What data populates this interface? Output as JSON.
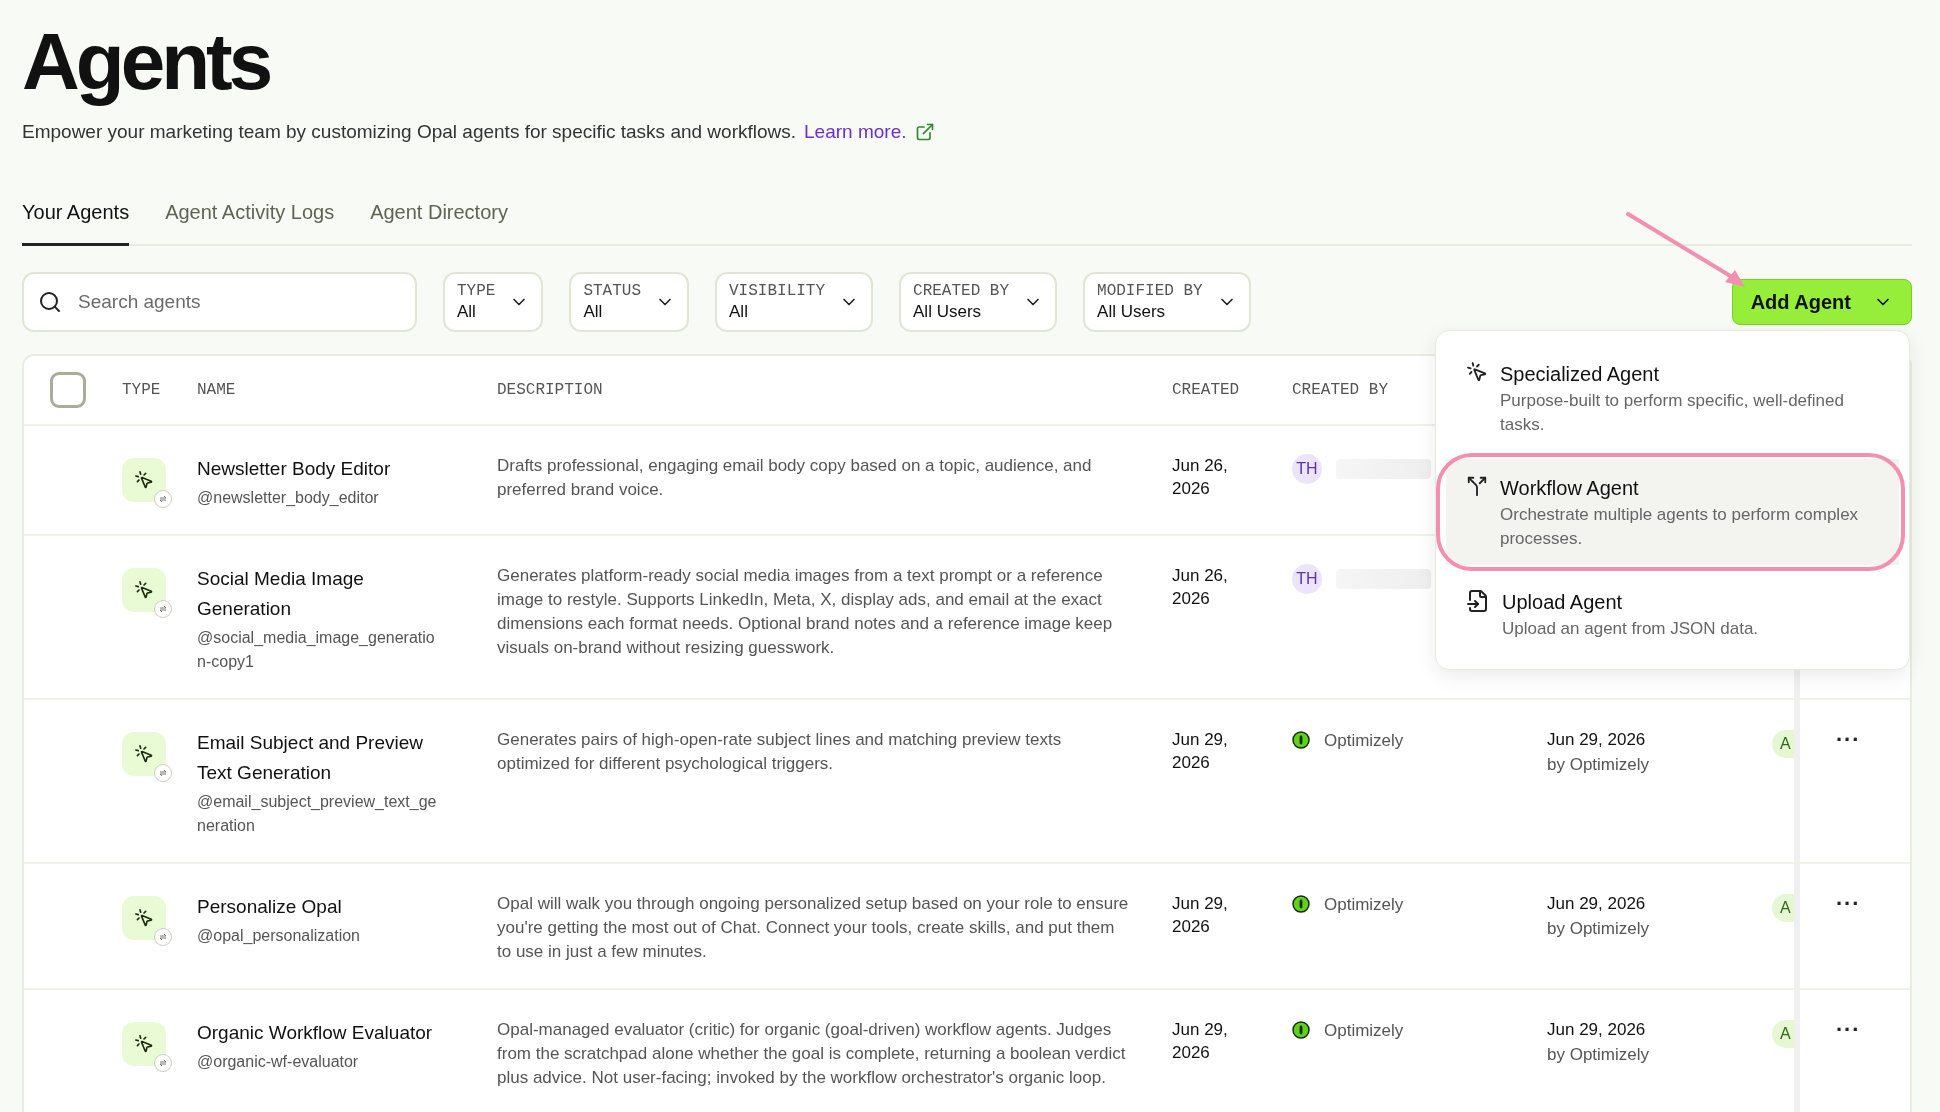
{
  "page": {
    "title": "Agents",
    "subtitle": "Empower your marketing team by customizing Opal agents for specific tasks and workflows.",
    "link": "Learn more."
  },
  "tabs": [
    {
      "label": "Your Agents",
      "selected": true
    },
    {
      "label": "Agent Activity Logs",
      "selected": false
    },
    {
      "label": "Agent Directory",
      "selected": false
    }
  ],
  "search": {
    "placeholder": "Search agents"
  },
  "filters": [
    {
      "label": "TYPE",
      "value": "All"
    },
    {
      "label": "STATUS",
      "value": "All"
    },
    {
      "label": "VISIBILITY",
      "value": "All"
    },
    {
      "label": "CREATED BY",
      "value": "All Users"
    },
    {
      "label": "MODIFIED BY",
      "value": "All Users"
    }
  ],
  "add_button": {
    "label": "Add Agent",
    "expanded": true
  },
  "menu": [
    {
      "kind": "specialized",
      "title": "Specialized Agent",
      "description": "Purpose-built to perform specific, well-defined tasks.",
      "selected": false
    },
    {
      "kind": "workflow",
      "title": "Workflow Agent",
      "description": "Orchestrate multiple agents to perform complex processes.",
      "selected": true
    },
    {
      "kind": "upload",
      "title": "Upload Agent",
      "description": "Upload an agent from JSON data.",
      "selected": false
    }
  ],
  "table": {
    "select_all": {
      "checked": false
    },
    "columns": [
      "TYPE",
      "NAME",
      "DESCRIPTION",
      "CREATED",
      "CREATED BY"
    ],
    "rows": [
      {
        "name": "Newsletter Body Editor",
        "handle": "@newsletter_body_editor",
        "description": "Drafts professional, engaging email body copy based on a topic, audience, and preferred brand voice.",
        "created": "Jun 26, 2026",
        "creator": {
          "kind": "avatar",
          "text": "TH"
        }
      },
      {
        "name": "Social Media Image Generation",
        "handle": "@social_media_image_generation-copy1",
        "description": "Generates platform-ready social media images from a text prompt or a reference image to restyle. Supports LinkedIn, Meta, X, display ads, and email at the exact dimensions each format needs. Optional brand notes and a reference image keep visuals on-brand without resizing guesswork.",
        "created": "Jun 26, 2026",
        "creator": {
          "kind": "avatar",
          "text": "TH"
        }
      },
      {
        "name": "Email Subject and Preview Text Generation",
        "handle": "@email_subject_preview_text_generation",
        "description": "Generates pairs of high-open-rate subject lines and matching preview texts optimized for different psychological triggers.",
        "created": "Jun 29, 2026",
        "creator": {
          "kind": "org",
          "text": "Optimizely"
        },
        "modified": "Jun 29, 2026",
        "modified_by": "by Optimizely",
        "column_7": "A",
        "actions": "..."
      },
      {
        "name": "Personalize Opal",
        "handle": "@opal_personalization",
        "description": "Opal will walk you through ongoing personalized setup based on your role to ensure you're getting the most out of Chat. Connect your tools, create skills, and put them to use in just a few minutes.",
        "created": "Jun 29, 2026",
        "creator": {
          "kind": "org",
          "text": "Optimizely"
        },
        "modified": "Jun 29, 2026",
        "modified_by": "by Optimizely",
        "column_7": "A",
        "actions": "..."
      },
      {
        "name": "Organic Workflow Evaluator",
        "handle": "@organic-wf-evaluator",
        "description": "Opal-managed evaluator (critic) for organic (goal-driven) workflow agents. Judges from the scratchpad alone whether the goal is complete, returning a boolean verdict plus advice. Not user-facing; invoked by the workflow orchestrator's organic loop.",
        "created": "Jun 29, 2026",
        "creator": {
          "kind": "org",
          "text": "Optimizely"
        },
        "modified": "Jun 29, 2026",
        "modified_by": "by Optimizely",
        "column_7": "A",
        "actions": "..."
      }
    ]
  }
}
